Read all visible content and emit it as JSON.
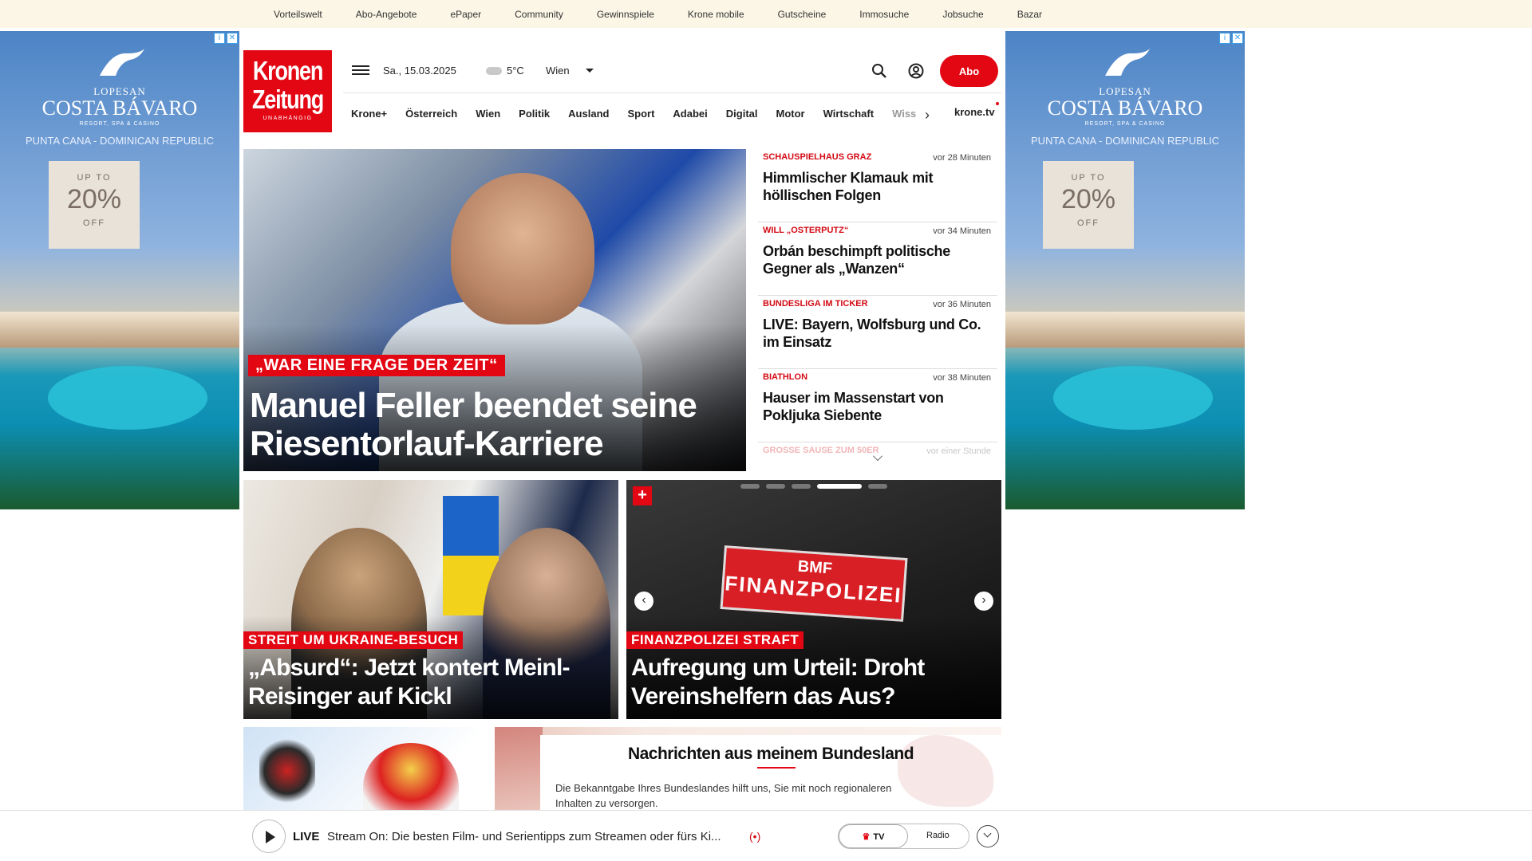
{
  "topbar": {
    "links": [
      "Vorteilswelt",
      "Abo-Angebote",
      "ePaper",
      "Community",
      "Gewinnspiele",
      "Krone mobile",
      "Gutscheine",
      "Immosuche",
      "Jobsuche",
      "Bazar"
    ]
  },
  "ads": {
    "brand_top": "LOPESAN",
    "brand": "COSTA BÁVARO",
    "brand_sub": "RESORT, SPA & CASINO",
    "region": "PUNTA CANA - DOMINICAN REPUBLIC",
    "offer_up_to": "UP TO",
    "offer_value": "20%",
    "offer_off": "OFF",
    "ad_choice_info": "i",
    "ad_choice_close": "✕"
  },
  "header": {
    "logo_line1": "Kronen",
    "logo_line2": "Zeitung",
    "logo_tagline": "UNABHÄNGIG",
    "date": "Sa., 15.03.2025",
    "temperature": "5°C",
    "region": "Wien",
    "abo_label": "Abo",
    "icons": {
      "menu": "hamburger-menu-icon",
      "search": "search-icon",
      "account": "account-icon"
    }
  },
  "nav": {
    "items": [
      "Krone+",
      "Österreich",
      "Wien",
      "Politik",
      "Ausland",
      "Sport",
      "Adabei",
      "Digital",
      "Motor",
      "Wirtschaft",
      "Wiss"
    ],
    "next_arrow": "›",
    "tv_link": "krone.tv"
  },
  "hero": {
    "kicker": "„WAR EINE FRAGE DER ZEIT“",
    "title": "Manuel Feller beendet seine Riesentorlauf-Karriere"
  },
  "ticker": [
    {
      "category": "SCHAUSPIELHAUS GRAZ",
      "time": "vor 28 Minuten",
      "headline": "Himmlischer Klamauk mit höllischen Folgen"
    },
    {
      "category": "WILL „OSTERPUTZ“",
      "time": "vor 34 Minuten",
      "headline": "Orbán beschimpft politische Gegner als „Wanzen“"
    },
    {
      "category": "BUNDESLIGA IM TICKER",
      "time": "vor 36 Minuten",
      "headline": "LIVE: Bayern, Wolfsburg und Co. im Einsatz"
    },
    {
      "category": "BIATHLON",
      "time": "vor 38 Minuten",
      "headline": "Hauser im Massenstart von Pokljuka Siebente"
    },
    {
      "category": "GROSSE SAUSE ZUM 50ER",
      "time": "vor einer Stunde",
      "headline": ""
    }
  ],
  "cards": [
    {
      "kicker": "STREIT UM UKRAINE-BESUCH",
      "title": "„Absurd“: Jetzt kontert Meinl-Reisinger auf Kickl"
    },
    {
      "kicker": "FINANZPOLIZEI STRAFT",
      "title": "Aufregung um Urteil: Droht Vereinshelfern das Aus?",
      "plus_badge": "+",
      "badge_line1": "BMF",
      "badge_line2": "FINANZPOLIZEI",
      "prev_arrow": "‹",
      "next_arrow": "›"
    }
  ],
  "carousel": {
    "slides": 5,
    "active_index": 3
  },
  "bundesland": {
    "title": "Nachrichten aus meinem Bundesland",
    "text": "Die Bekanntgabe Ihres Bundeslandes hilft uns, Sie mit noch regionaleren Inhalten zu versorgen."
  },
  "livebar": {
    "label": "LIVE",
    "text": "Stream On: Die besten Film- und Serientipps zum Streamen oder fürs Ki...",
    "broadcast_icon": "(•)",
    "tv_label": "TV",
    "tv_crown": "♛",
    "radio_label": "Radio"
  }
}
